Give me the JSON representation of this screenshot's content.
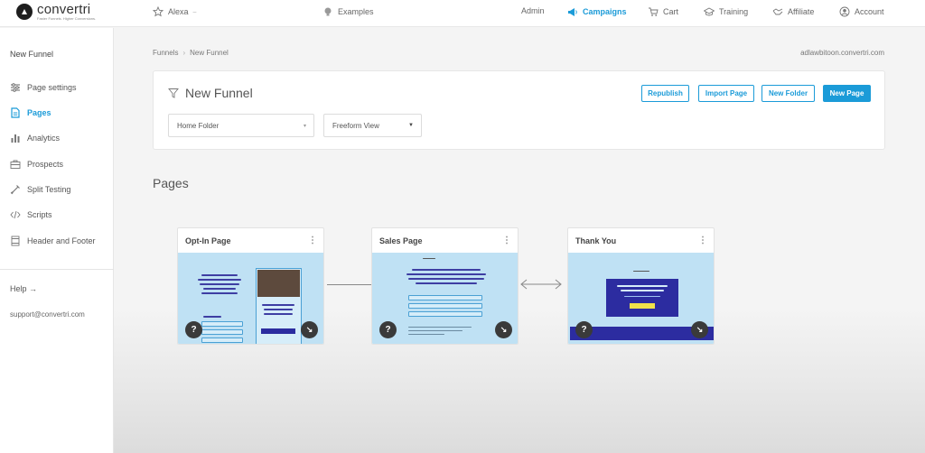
{
  "app": {
    "logo_name": "convertri",
    "logo_tagline": "Faster Funnels. Higher Conversions."
  },
  "topnav": {
    "user": "Alexa",
    "examples": "Examples",
    "admin": "Admin",
    "campaigns": "Campaigns",
    "cart": "Cart",
    "training": "Training",
    "affiliate": "Affiliate",
    "account": "Account"
  },
  "sidebar": {
    "title": "New Funnel",
    "items": [
      {
        "label": "Page settings",
        "icon": "sliders-icon"
      },
      {
        "label": "Pages",
        "icon": "document-icon"
      },
      {
        "label": "Analytics",
        "icon": "bar-chart-icon"
      },
      {
        "label": "Prospects",
        "icon": "briefcase-icon"
      },
      {
        "label": "Split Testing",
        "icon": "flask-icon"
      },
      {
        "label": "Scripts",
        "icon": "code-icon"
      },
      {
        "label": "Header and Footer",
        "icon": "layout-icon"
      }
    ],
    "help": "Help →",
    "support_email": "support@convertri.com"
  },
  "breadcrumb": {
    "root": "Funnels",
    "separator": "›",
    "current": "New Funnel"
  },
  "domain": "adlawbitoon.convertri.com",
  "panel": {
    "title": "New Funnel",
    "buttons": {
      "republish": "Republish",
      "import_page": "Import Page",
      "new_folder": "New Folder",
      "new_page": "New Page"
    },
    "folder_select": "Home Folder",
    "view_select": "Freeform View"
  },
  "pages_heading": "Pages",
  "pages": [
    {
      "title": "Opt-In Page",
      "menu": "⋮",
      "help": "?",
      "expand": "↘"
    },
    {
      "title": "Sales Page",
      "menu": "⋮",
      "help": "?",
      "expand": "↘"
    },
    {
      "title": "Thank You",
      "menu": "⋮",
      "help": "?",
      "expand": "↘"
    }
  ],
  "colors": {
    "accent": "#1b9bd8",
    "thumbnail_bg": "#bfe1f4",
    "thumbnail_text": "#3e3ea3"
  }
}
